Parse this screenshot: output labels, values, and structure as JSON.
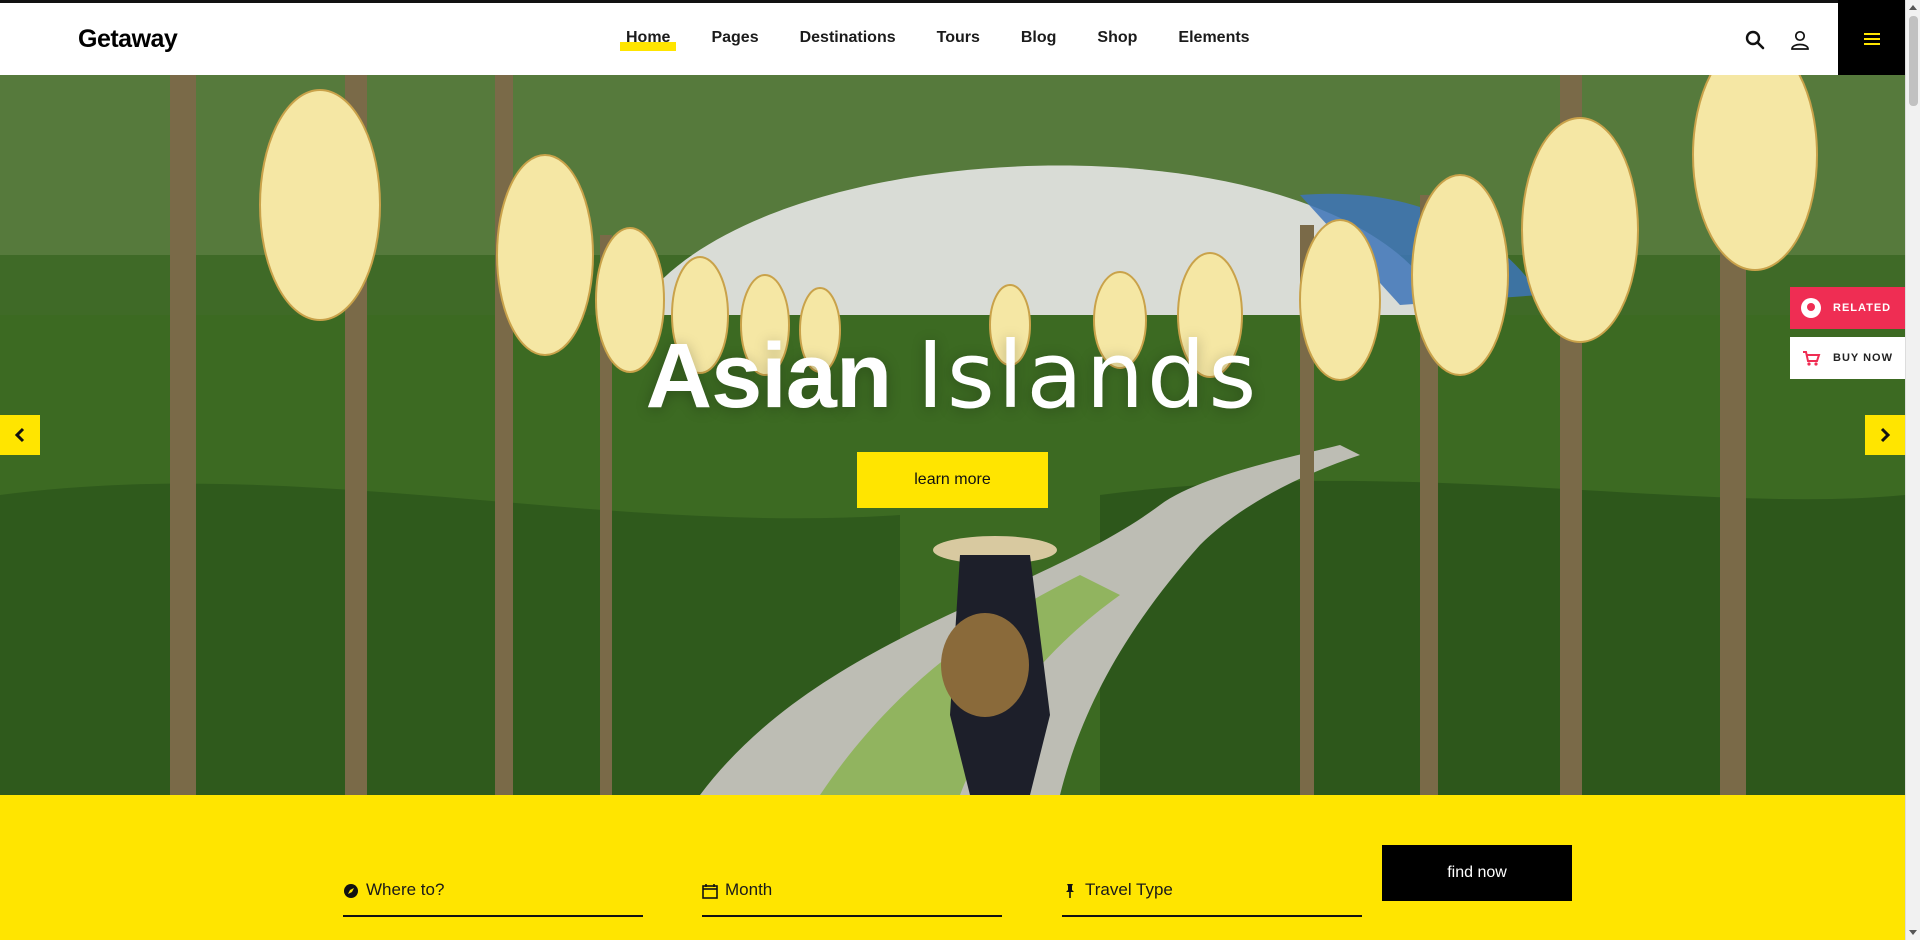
{
  "header": {
    "logo": "Getaway",
    "nav": [
      {
        "label": "Home",
        "active": true
      },
      {
        "label": "Pages"
      },
      {
        "label": "Destinations"
      },
      {
        "label": "Tours"
      },
      {
        "label": "Blog"
      },
      {
        "label": "Shop"
      },
      {
        "label": "Elements"
      }
    ],
    "icons": [
      "search-icon",
      "user-icon",
      "hamburger-menu-icon"
    ]
  },
  "hero": {
    "title_bold": "Asian",
    "title_light": "Islands",
    "cta_label": "learn more",
    "prev_icon": "chevron-left-icon",
    "next_icon": "chevron-right-icon"
  },
  "side_buttons": {
    "related_label": "RELATED",
    "buy_label": "BUY NOW"
  },
  "search": {
    "where_placeholder": "Where to?",
    "month_placeholder": "Month",
    "type_placeholder": "Travel Type",
    "submit_label": "find now"
  },
  "colors": {
    "accent": "#ffe500",
    "related": "#ef2d53",
    "dark": "#000000"
  }
}
